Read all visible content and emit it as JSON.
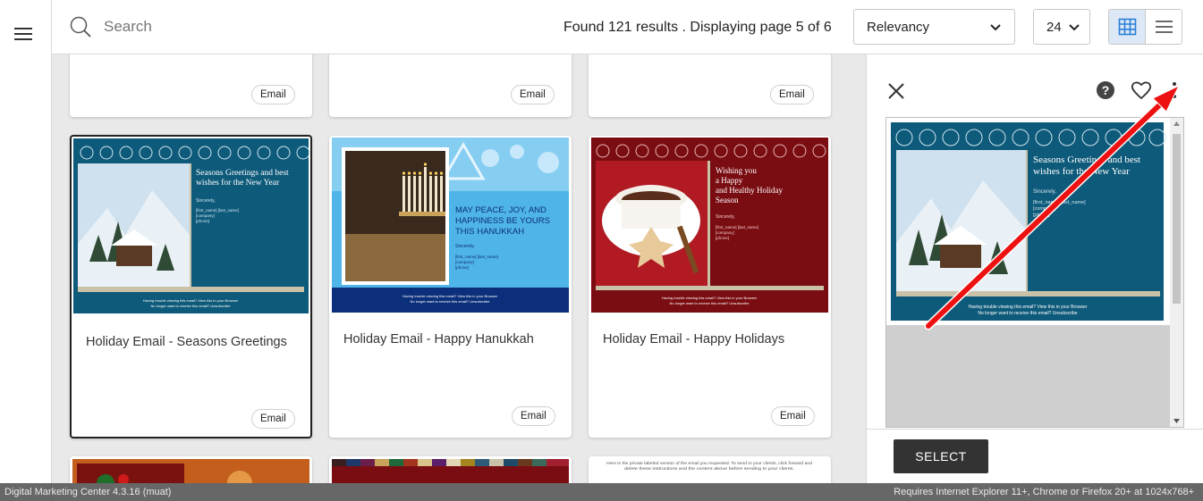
{
  "topbar": {
    "search_placeholder": "Search",
    "results_text": "Found 121 results . Displaying page 5 of 6",
    "sort_value": "Relevancy",
    "per_page_value": "24",
    "view_mode": "grid"
  },
  "cards": [
    {
      "title": "",
      "badge": "Email"
    },
    {
      "title": "",
      "badge": "Email"
    },
    {
      "title": "",
      "badge": "Email"
    },
    {
      "title": "Holiday Email - Seasons Greetings",
      "badge": "Email",
      "selected": true
    },
    {
      "title": "Holiday Email - Happy Hanukkah",
      "badge": "Email"
    },
    {
      "title": "Holiday Email - Happy Holidays",
      "badge": "Email"
    }
  ],
  "thumbnails": {
    "seasons": {
      "heading": "Seasons Greetings and best wishes for the New Year",
      "sincerely": "Sincerely,",
      "fields": [
        "[first_name] [last_name]",
        "[company]",
        "[phone]"
      ],
      "footer1": "Having trouble viewing this email? View this in your Browser",
      "footer2": "No longer want to receive this email? Unsubscribe"
    },
    "hanukkah": {
      "heading_a": "MAY PEACE, JOY, AND",
      "heading_b": "HAPPINESS BE YOURS",
      "heading_c": "THIS HANUKKAH",
      "sincerely": "Sincerely,",
      "fields": [
        "[first_name] [last_name]",
        "[company]",
        "[phone]"
      ],
      "footer1": "Having trouble viewing this email? View this in your Browser",
      "footer2": "No longer want to receive this email? Unsubscribe"
    },
    "holidays": {
      "heading_lines": [
        "Wishing you",
        "a Happy",
        "and Healthy Holiday",
        "Season"
      ],
      "sincerely": "Sincerely,",
      "fields": [
        "[first_name] [last_name]",
        "[company]",
        "[phone]"
      ],
      "footer1": "Having trouble viewing this email? View this in your Browser",
      "footer2": "No longer want to receive this email? Unsubscribe"
    },
    "bottom_right_note": "Here is the private labeled version of the email you requested. To send to your clients, click forward and delete these instructions and the content above before sending to your clients."
  },
  "panel": {
    "select_label": "SELECT",
    "preview_heading": "Seasons Greetings and best wishes for the New Year"
  },
  "status": {
    "left": "Digital Marketing Center 4.3.16 (muat)",
    "right": "Requires Internet Explorer 11+, Chrome or Firefox 20+ at 1024x768+"
  },
  "colors": {
    "accent_select": "#dce8f5",
    "teal": "#0e5a7a",
    "maroon": "#7a0d12",
    "hanukkah_blue": "#4fb4e8",
    "arrow": "#ee1111"
  }
}
